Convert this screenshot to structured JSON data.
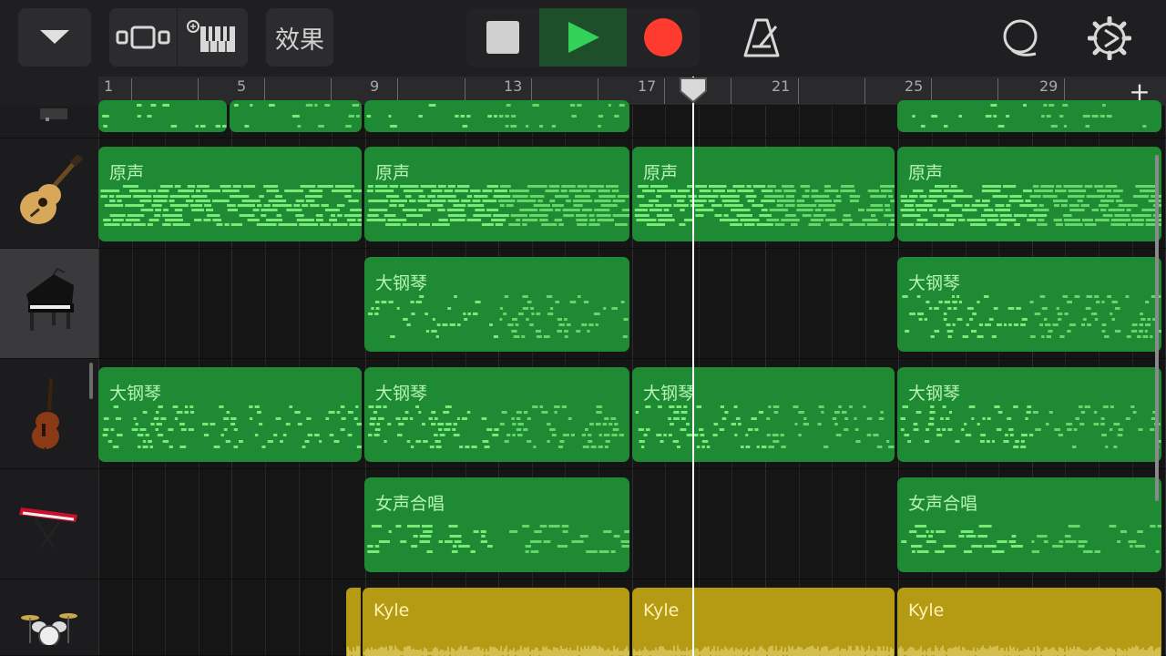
{
  "toolbar": {
    "dropdown_icon": "chevron-down-icon",
    "tracks_view_icon": "tracks-view-icon",
    "instrument_icon": "keyboard-settings-icon",
    "fx_label": "效果",
    "stop_icon": "stop-icon",
    "play_icon": "play-icon",
    "record_icon": "record-icon",
    "metronome_icon": "metronome-icon",
    "loop_icon": "loop-icon",
    "settings_icon": "gear-icon",
    "colors": {
      "play_bg": "#1d4f2a",
      "play": "#34d158",
      "record": "#ff3b30",
      "stop": "#d0d0d0"
    }
  },
  "ruler": {
    "bar_numbers": [
      "1",
      "5",
      "9",
      "13",
      "17",
      "21",
      "25",
      "29"
    ],
    "add_label": "+"
  },
  "tracks": [
    {
      "name": "top-track",
      "icon": "instrument-icon"
    },
    {
      "name": "acoustic-guitar",
      "icon": "acoustic-guitar-icon"
    },
    {
      "name": "grand-piano",
      "icon": "grand-piano-icon"
    },
    {
      "name": "cello",
      "icon": "cello-icon"
    },
    {
      "name": "synth-keyboard",
      "icon": "keyboard-icon"
    },
    {
      "name": "drum-kit",
      "icon": "drum-kit-icon"
    }
  ],
  "regions": {
    "r1_name": "原声",
    "r2_name": "原声",
    "r3_name": "原声",
    "r4_name": "原声",
    "p1_name": "大钢琴",
    "p2_name": "大钢琴",
    "c1_name": "大钢琴",
    "c2_name": "大钢琴",
    "c3_name": "大钢琴",
    "c4_name": "大钢琴",
    "v1_name": "女声合唱",
    "v2_name": "女声合唱",
    "k1_name": "Kyle",
    "k2_name": "Kyle",
    "k3_name": "Kyle"
  },
  "colors": {
    "midi_region": "#1e8a34",
    "midi_notes": "#7cf07a",
    "audio_region": "#b59a14",
    "audio_wave": "#fff0a0"
  }
}
